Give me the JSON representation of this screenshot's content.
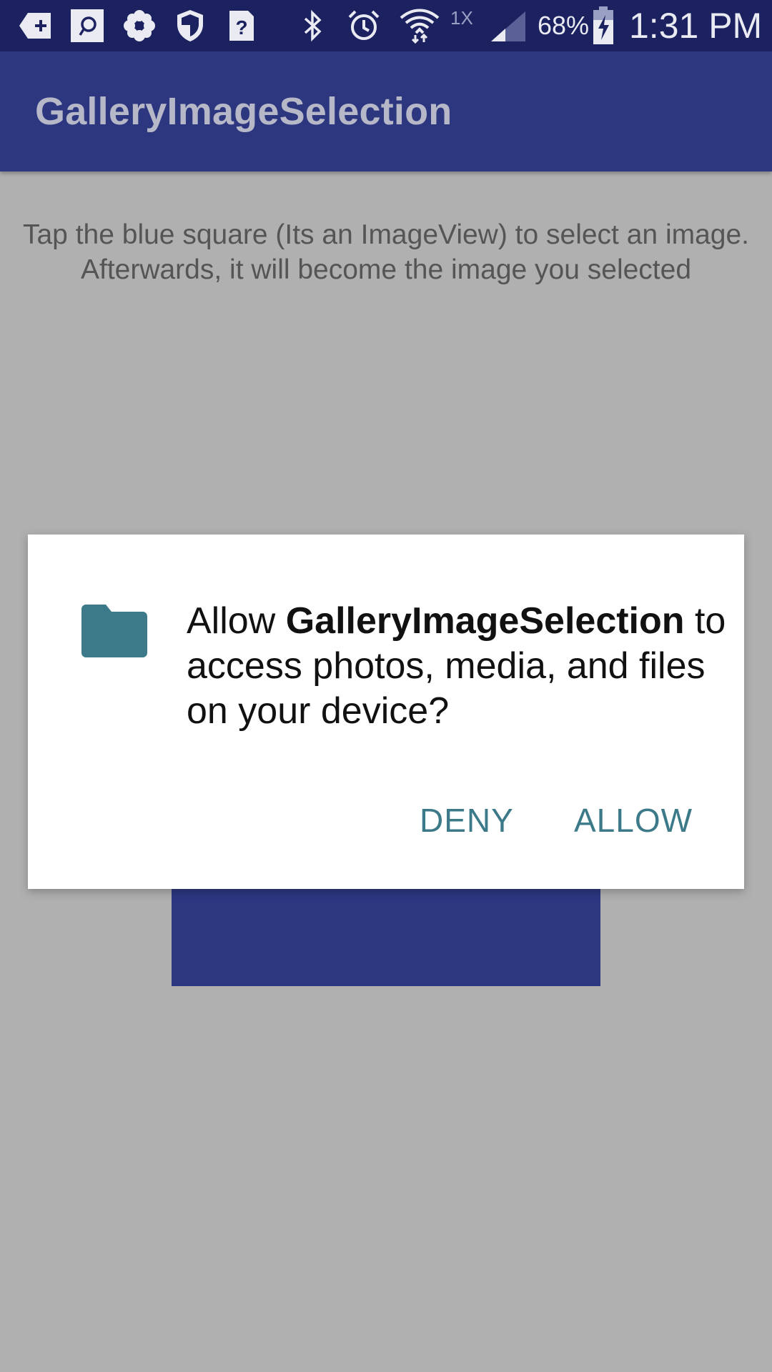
{
  "status_bar": {
    "icons": [
      "add-icon",
      "chat-icon",
      "flower-icon",
      "shield-icon",
      "help-icon",
      "bluetooth-icon",
      "alarm-icon",
      "wifi-icon",
      "signal-icon",
      "battery-charging-icon"
    ],
    "network_label": "1X",
    "battery_percent": "68%",
    "time": "1:31 PM"
  },
  "app_bar": {
    "title": "GalleryImageSelection"
  },
  "main": {
    "instruction": "Tap the blue square (Its an ImageView) to select an image. Afterwards, it will become the image you selected",
    "image_view_color": "#2c3780"
  },
  "dialog": {
    "icon": "folder-icon",
    "message_prefix": "Allow ",
    "app_name": "GalleryImageSelection",
    "message_suffix": " to access photos, media, and files on your device?",
    "deny_label": "DENY",
    "allow_label": "ALLOW",
    "accent_color": "#3c7a8a"
  },
  "colors": {
    "status_bar": "#1c2260",
    "app_bar": "#2c3780",
    "scrim_background": "#b0b0b0"
  }
}
